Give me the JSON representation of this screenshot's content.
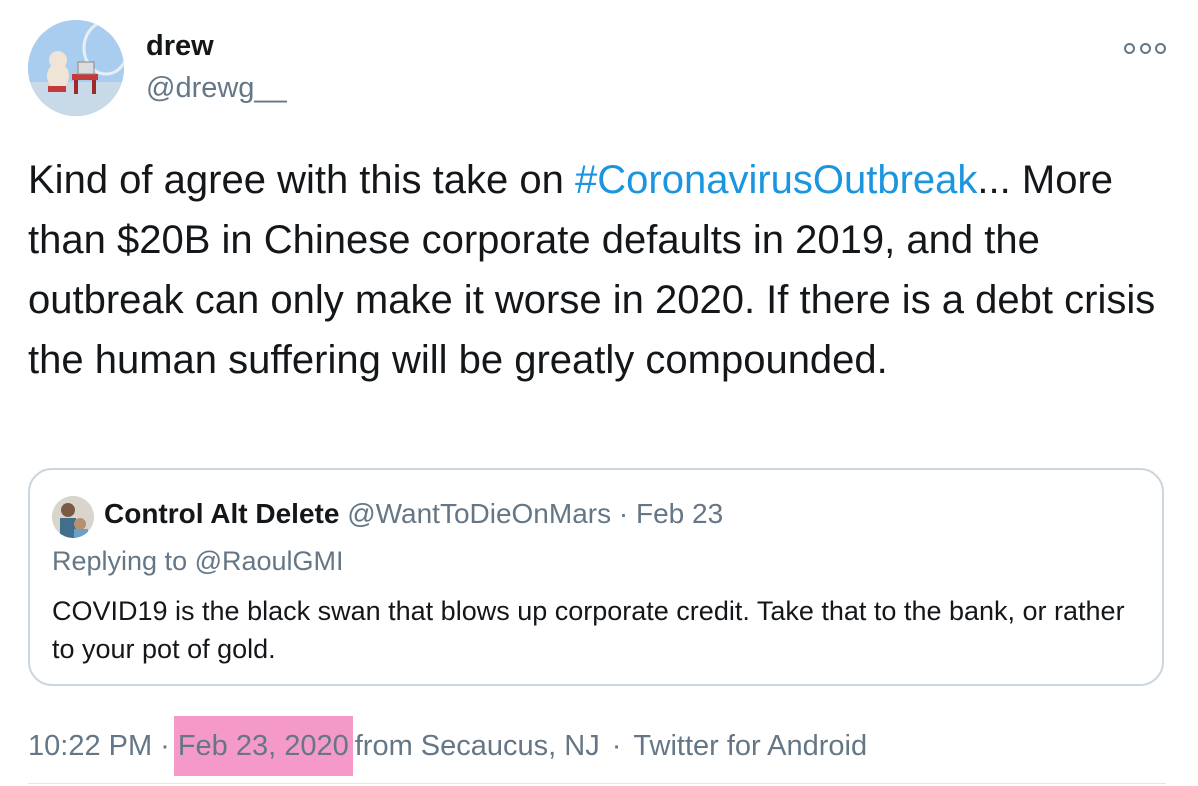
{
  "author": {
    "display_name": "drew",
    "handle": "@drewg__"
  },
  "tweet": {
    "text_before": "Kind of agree with this take on ",
    "hashtag": "#CoronavirusOutbreak",
    "text_after": "... More than $20B in Chinese corporate defaults in 2019, and the outbreak can only make it worse in 2020. If there is a debt crisis the human suffering will be greatly compounded."
  },
  "quoted_tweet": {
    "display_name": "Control Alt Delete",
    "handle": "@WantToDieOnMars",
    "separator": "·",
    "date": "Feb 23",
    "replying_to": "Replying to @RaoulGMI",
    "text": "COVID19 is the black swan that blows up corporate credit. Take that to the bank, or rather to your pot of gold."
  },
  "meta": {
    "time": "10:22 PM",
    "separator_1": "·",
    "date": "Feb 23, 2020",
    "location": "from Secaucus, NJ",
    "separator_2": "·",
    "source": "Twitter for Android"
  },
  "colors": {
    "link": "#1b95e0",
    "secondary_text": "#657786",
    "highlight": "#f59ac8",
    "border": "#ccd6dd"
  },
  "icons": {
    "more": "more-options-icon"
  }
}
